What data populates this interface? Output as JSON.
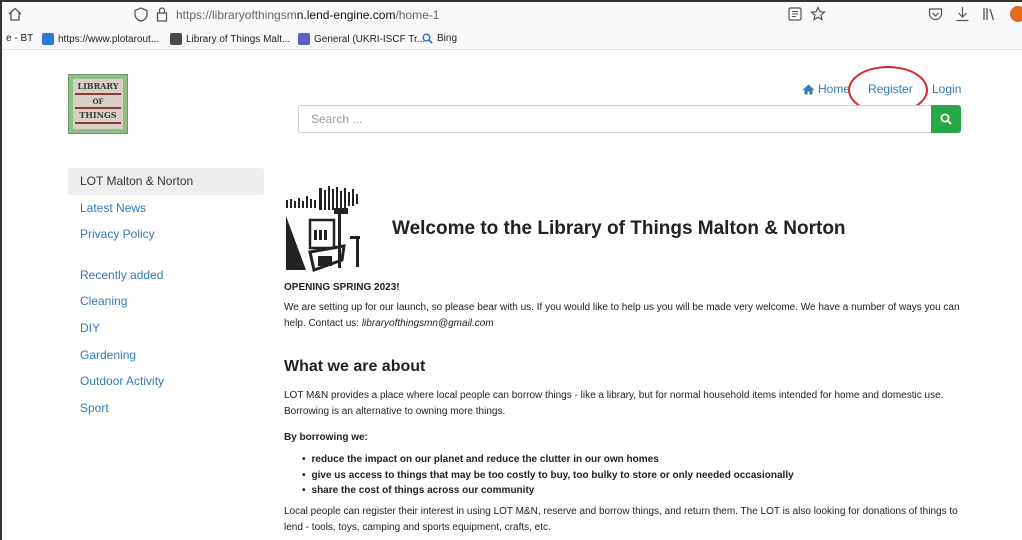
{
  "browser": {
    "url_prefix": "https://libraryofthingsm",
    "url_domain": "n.lend-engine.com",
    "url_path": "/home-1"
  },
  "bookmarks": [
    {
      "label": "e - BT",
      "icon": "none"
    },
    {
      "label": "https://www.plotarout...",
      "icon": "plotaroute-favicon",
      "color": "#2b7bd6"
    },
    {
      "label": "Library of Things Malt...",
      "icon": "lot-favicon",
      "color": "#4a4a4a"
    },
    {
      "label": "General (UKRI-ISCF Tr...",
      "icon": "teams-favicon",
      "color": "#5b5fc7"
    },
    {
      "label": "Bing",
      "icon": "search-icon",
      "color": "#2a6fd6"
    }
  ],
  "logo": {
    "line1": "LIBRARY",
    "line2": "OF",
    "line3": "THINGS"
  },
  "nav": {
    "home": "Home",
    "register": "Register",
    "login": "Login"
  },
  "search": {
    "placeholder": "Search ..."
  },
  "sidebar": {
    "items": [
      {
        "label": "LOT Malton & Norton",
        "active": true
      },
      {
        "label": "Latest News"
      },
      {
        "label": "Privacy Policy"
      },
      {
        "label": "Recently added"
      },
      {
        "label": "Cleaning"
      },
      {
        "label": "DIY"
      },
      {
        "label": "Gardening"
      },
      {
        "label": "Outdoor Activity"
      },
      {
        "label": "Sport"
      }
    ]
  },
  "content": {
    "welcome": "Welcome to the Library of Things Malton & Norton",
    "opening": "OPENING SPRING 2023!",
    "intro": "We are setting up for our launch, so please bear with us. If you would like to help us you will be made very welcome. We have a number of ways you can help. Contact us: ",
    "email": "libraryofthingsmn@gmail.com",
    "about_heading": "What we are about",
    "about_text": "LOT M&N provides a place where local people can borrow things - like a library, but for normal household items intended for home and domestic use. Borrowing is an alternative to owning more things.",
    "borrowing_heading": "By borrowing we:",
    "bullets": [
      "reduce the impact on our planet and reduce the clutter in our own homes",
      "give us access to things that may be too costly to buy, too bulky to store or only needed occasionally",
      "share the cost of things across our community"
    ],
    "register_text": "Local people can register their interest in using LOT M&N, reserve and borrow things, and return them. The LOT is also looking for donations of things to lend - tools, toys, camping and sports equipment, crafts, etc."
  },
  "colors": {
    "link": "#337ab7",
    "search_button": "#28a745",
    "annotation_circle": "#d3282a"
  }
}
